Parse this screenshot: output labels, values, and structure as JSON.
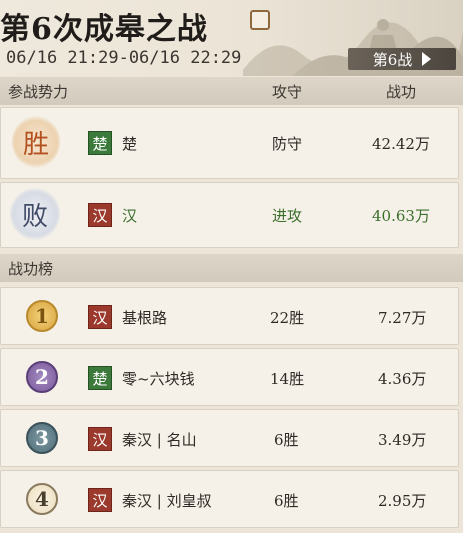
{
  "header": {
    "title": "第6次成皋之战",
    "time_range": "06/16 21:29-06/16 22:29",
    "battle_tag": "第6战"
  },
  "factions_section": {
    "col_name": "参战势力",
    "col_role": "攻守",
    "col_merit": "战功",
    "rows": [
      {
        "result": "胜",
        "badge": "楚",
        "name": "楚",
        "role": "防守",
        "merit": "42.42万"
      },
      {
        "result": "败",
        "badge": "汉",
        "name": "汉",
        "role": "进攻",
        "merit": "40.63万"
      }
    ]
  },
  "ranking_section": {
    "title": "战功榜",
    "rows": [
      {
        "rank": "1",
        "badge": "汉",
        "name": "基根路",
        "wins": "22胜",
        "merit": "7.27万"
      },
      {
        "rank": "2",
        "badge": "楚",
        "name": "零~六块钱",
        "wins": "14胜",
        "merit": "4.36万"
      },
      {
        "rank": "3",
        "badge": "汉",
        "name": "秦汉 | 名山",
        "wins": "6胜",
        "merit": "3.49万"
      },
      {
        "rank": "4",
        "badge": "汉",
        "name": "秦汉 | 刘皇叔",
        "wins": "6胜",
        "merit": "2.95万"
      }
    ]
  },
  "colors": {
    "han_badge": "#9b3a2c",
    "chu_badge": "#3c7a3c",
    "attack_text": "#3b6e2a",
    "medal_gold": "#d9a441",
    "medal_purple": "#7a5a9a",
    "medal_teal": "#4f6f7a"
  }
}
